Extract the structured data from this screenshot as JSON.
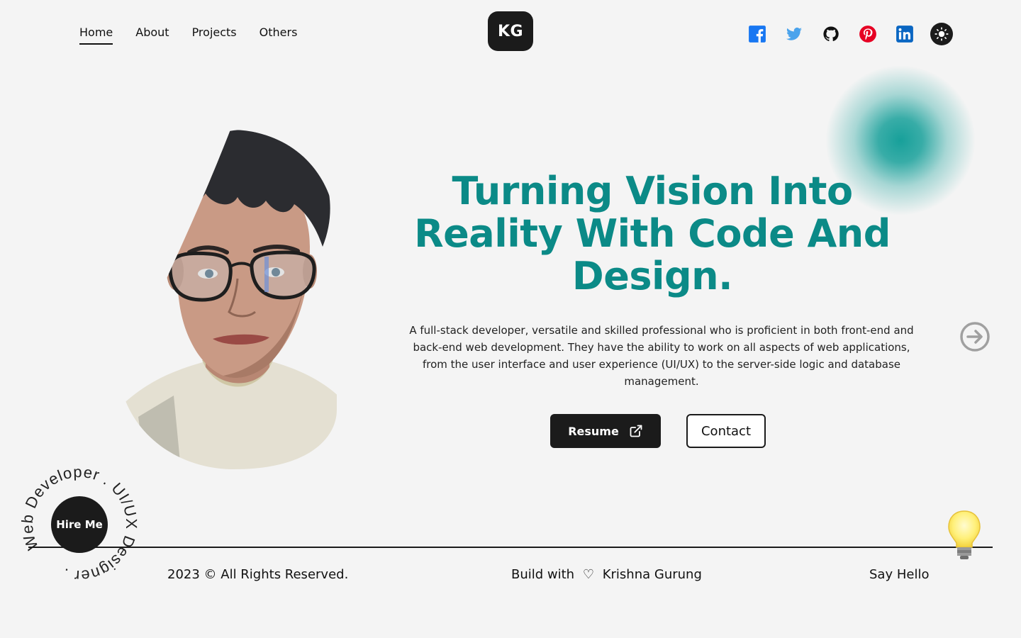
{
  "nav": {
    "links": [
      {
        "label": "Home",
        "active": true
      },
      {
        "label": "About"
      },
      {
        "label": "Projects"
      },
      {
        "label": "Others"
      }
    ],
    "logo": "KG",
    "socials": [
      "facebook-icon",
      "twitter-icon",
      "github-icon",
      "pinterest-icon",
      "linkedin-icon"
    ],
    "theme_toggle_icon": "sun-icon"
  },
  "hero": {
    "title_lines": [
      "Turning Vision Into",
      "Reality With Code And",
      "Design."
    ],
    "description": "A full-stack developer, versatile and skilled professional who is proficient in both front-end and back-end web development. They have the ability to work on all aspects of web applications, from the user interface and user experience (UI/UX) to the server-side logic and database management.",
    "resume_label": "Resume",
    "contact_label": "Contact"
  },
  "hire": {
    "label": "Hire Me",
    "ring_text": "Web Developer . UI/UX Designer . "
  },
  "footer": {
    "copyright": "2023 © All Rights Reserved.",
    "built_prefix": "Build with",
    "heart": "♡",
    "author": "Krishna Gurung",
    "say_hello": "Say Hello"
  },
  "colors": {
    "accent": "#0b8a87",
    "dark": "#1b1b1b",
    "background": "#f4f4f4",
    "glow": "#17a09a"
  }
}
